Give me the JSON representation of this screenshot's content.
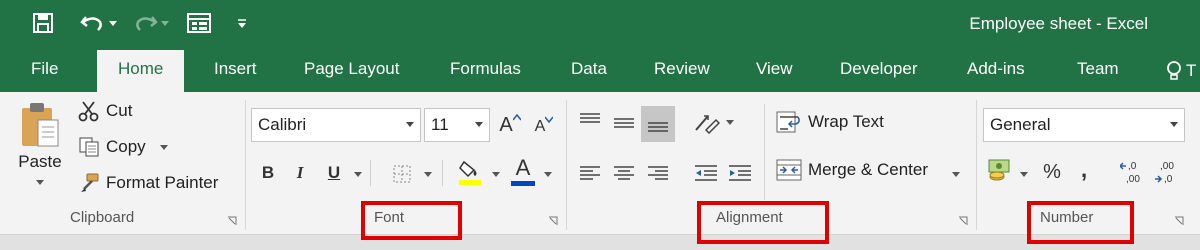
{
  "window": {
    "title": "Employee sheet - Excel"
  },
  "qat": {
    "customize_icon": "customize-qat-icon"
  },
  "tabs": [
    "File",
    "Home",
    "Insert",
    "Page Layout",
    "Formulas",
    "Data",
    "Review",
    "View",
    "Developer",
    "Add-ins",
    "Team"
  ],
  "tell_me": {
    "label": "T"
  },
  "clipboard": {
    "paste": "Paste",
    "cut": "Cut",
    "copy": "Copy",
    "format_painter": "Format Painter",
    "group_label": "Clipboard"
  },
  "font": {
    "name": "Calibri",
    "size": "11",
    "bold": "B",
    "italic": "I",
    "underline": "U",
    "increase": "A",
    "decrease": "A",
    "font_color": "A",
    "font_color_hex": "#0047c0",
    "group_label": "Font"
  },
  "alignment": {
    "wrap_text": "Wrap Text",
    "merge_center": "Merge & Center",
    "group_label": "Alignment"
  },
  "number": {
    "format": "General",
    "percent": "%",
    "comma": ",",
    "group_label": "Number"
  },
  "colors": {
    "accent": "#217346",
    "highlight": "#e00000"
  }
}
